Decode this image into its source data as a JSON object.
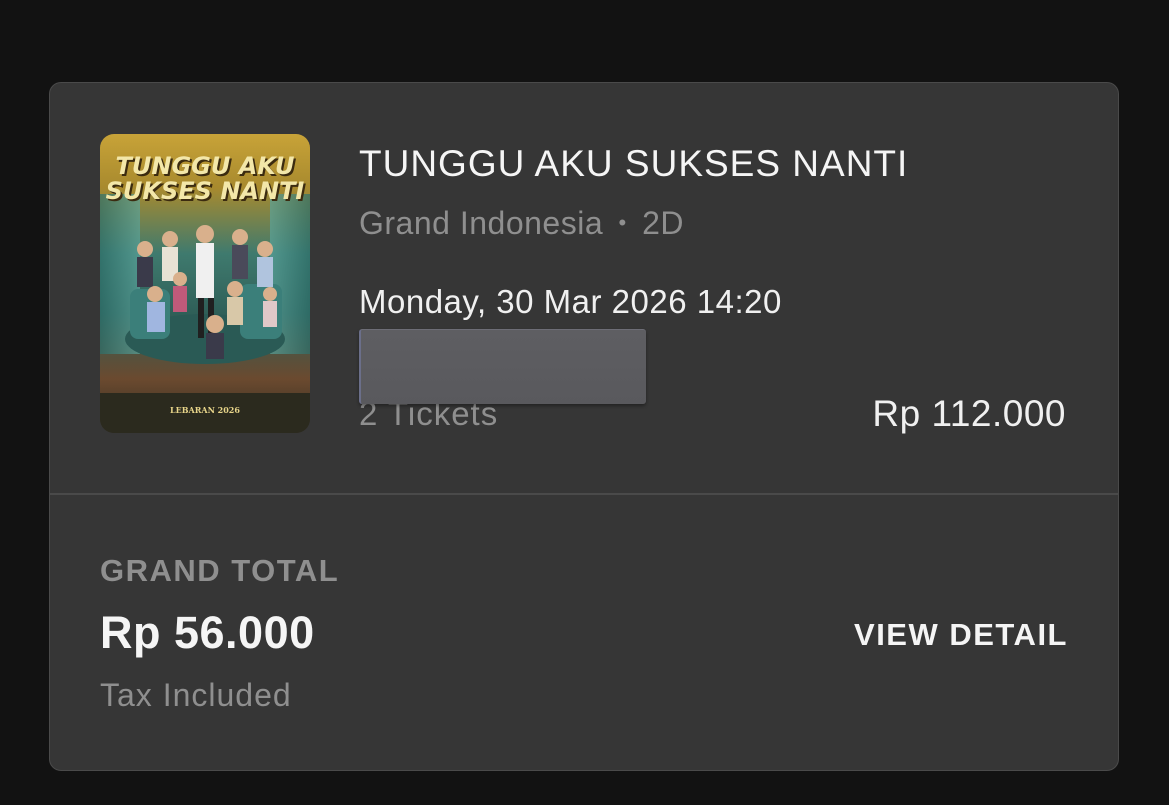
{
  "booking": {
    "poster": {
      "title_art": "TUNGGU AKU SUKSES NANTI",
      "release_text": "LEBARAN 2026"
    },
    "movie_title": "TUNGGU AKU SUKSES NANTI",
    "cinema": "Grand Indonesia",
    "separator": "•",
    "format": "2D",
    "showtime": "Monday, 30 Mar 2026 14:20",
    "tickets": "2 Tickets",
    "price": "Rp 112.000"
  },
  "summary": {
    "grand_total_label": "GRAND TOTAL",
    "grand_total_amount": "Rp 56.000",
    "tax_note": "Tax Included",
    "view_detail_label": "VIEW DETAIL"
  }
}
